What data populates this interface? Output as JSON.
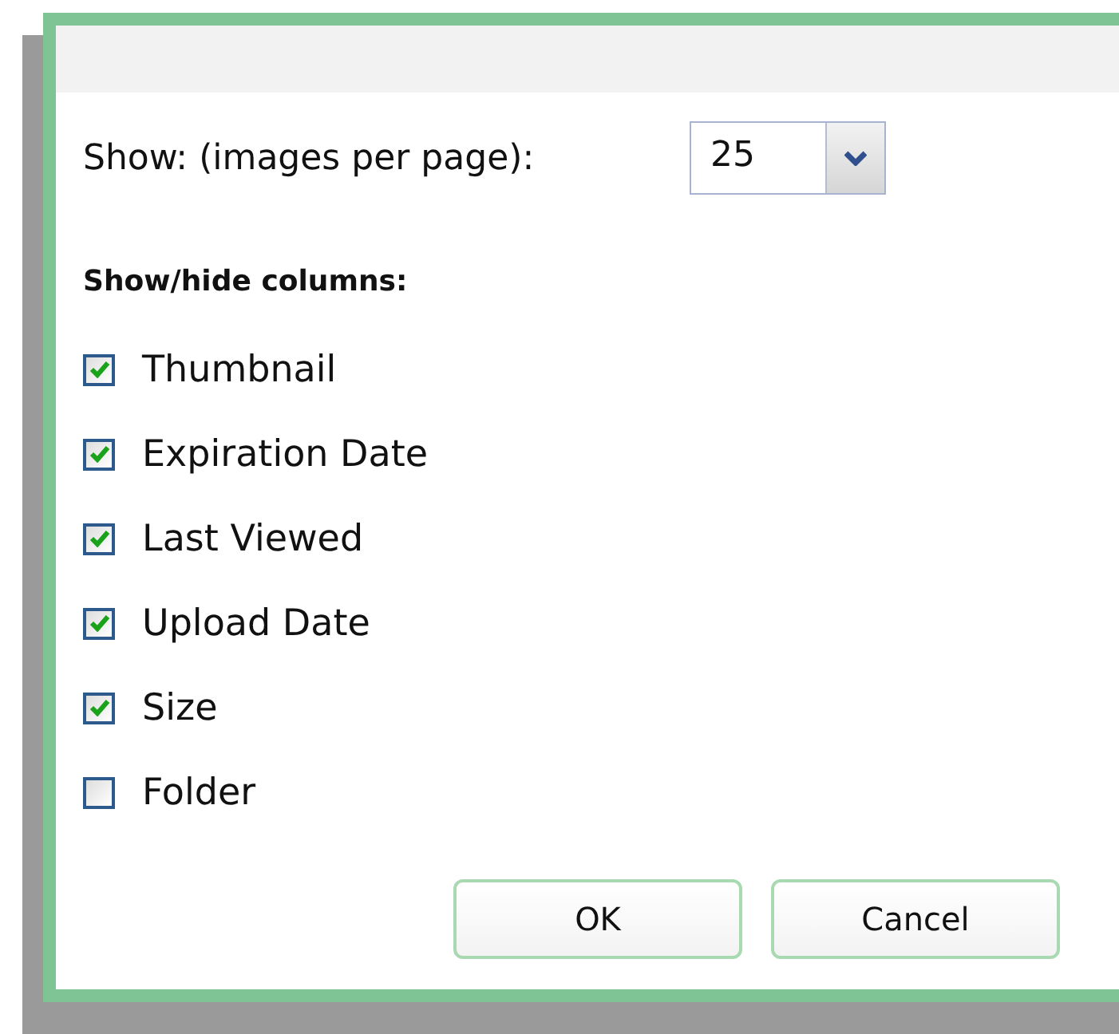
{
  "page_size": {
    "label": "Show: (images per page):",
    "value": "25"
  },
  "columns": {
    "heading": "Show/hide columns:",
    "items": [
      {
        "label": "Thumbnail",
        "checked": true
      },
      {
        "label": "Expiration Date",
        "checked": true
      },
      {
        "label": "Last Viewed",
        "checked": true
      },
      {
        "label": "Upload Date",
        "checked": true
      },
      {
        "label": "Size",
        "checked": true
      },
      {
        "label": "Folder",
        "checked": false
      }
    ]
  },
  "buttons": [
    "OK",
    "Cancel"
  ]
}
